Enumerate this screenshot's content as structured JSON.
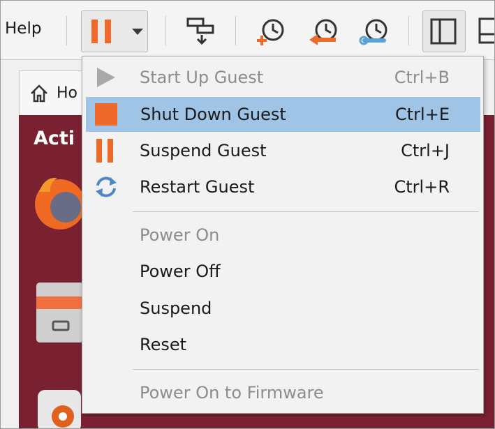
{
  "menubar": {
    "help_label": "Help"
  },
  "tab": {
    "label": "Ho"
  },
  "desktop": {
    "activities_label": "Acti"
  },
  "menu": {
    "guest_items": [
      {
        "label": "Start Up Guest",
        "shortcut": "Ctrl+B",
        "icon": "play-icon",
        "enabled": false,
        "highlighted": false
      },
      {
        "label": "Shut Down Guest",
        "shortcut": "Ctrl+E",
        "icon": "stop-icon",
        "enabled": true,
        "highlighted": true
      },
      {
        "label": "Suspend Guest",
        "shortcut": "Ctrl+J",
        "icon": "pause-icon",
        "enabled": true,
        "highlighted": false
      },
      {
        "label": "Restart Guest",
        "shortcut": "Ctrl+R",
        "icon": "restart-icon",
        "enabled": true,
        "highlighted": false
      }
    ],
    "power_items": [
      {
        "label": "Power On",
        "enabled": false
      },
      {
        "label": "Power Off",
        "enabled": true
      },
      {
        "label": "Suspend",
        "enabled": true
      },
      {
        "label": "Reset",
        "enabled": true
      }
    ],
    "firmware_item": {
      "label": "Power On to Firmware",
      "enabled": false
    }
  },
  "colors": {
    "accent_orange": "#ee6a2a",
    "highlight_blue": "#9fc4e6",
    "desktop_bg": "#7a2131",
    "disabled_text": "#8c8c8c"
  }
}
